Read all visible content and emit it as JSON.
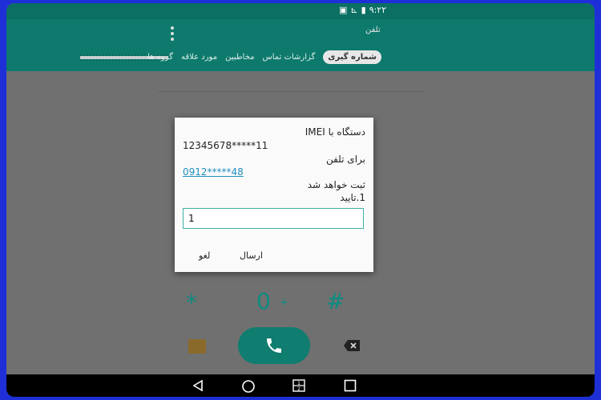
{
  "statusbar": {
    "time": "۹:۲۲",
    "battery": "▮",
    "signal": "⊾",
    "notif": "▣"
  },
  "appbar": {
    "title": "تلفن"
  },
  "tabs": [
    {
      "label": "شماره گیری",
      "active": true
    },
    {
      "label": "گزارشات تماس",
      "active": false
    },
    {
      "label": "مخاطبین",
      "active": false
    },
    {
      "label": "مورد علاقه",
      "active": false
    },
    {
      "label": "گروه ها",
      "active": false
    }
  ],
  "dialpad": {
    "star": "*",
    "zero": "0",
    "plus": "+",
    "hash": "#"
  },
  "dialog": {
    "line1": "دستگاه با IMEI",
    "imei": "12345678*****11",
    "line2": "برای تلفن",
    "phone": "0912*****48",
    "line3": "ثبت خواهد شد",
    "line4": "1.تایید",
    "input_value": "1",
    "send_label": "ارسال",
    "cancel_label": "لغو"
  },
  "colors": {
    "primary": "#0d7a6d",
    "accent": "#1f8fbf",
    "frame": "#1f2fd8"
  },
  "icons": {
    "back": "back-icon",
    "home": "home-icon",
    "split": "split-screen-icon",
    "recents": "recents-icon",
    "call": "phone-icon",
    "sms": "message-icon",
    "backspace": "backspace-icon"
  }
}
